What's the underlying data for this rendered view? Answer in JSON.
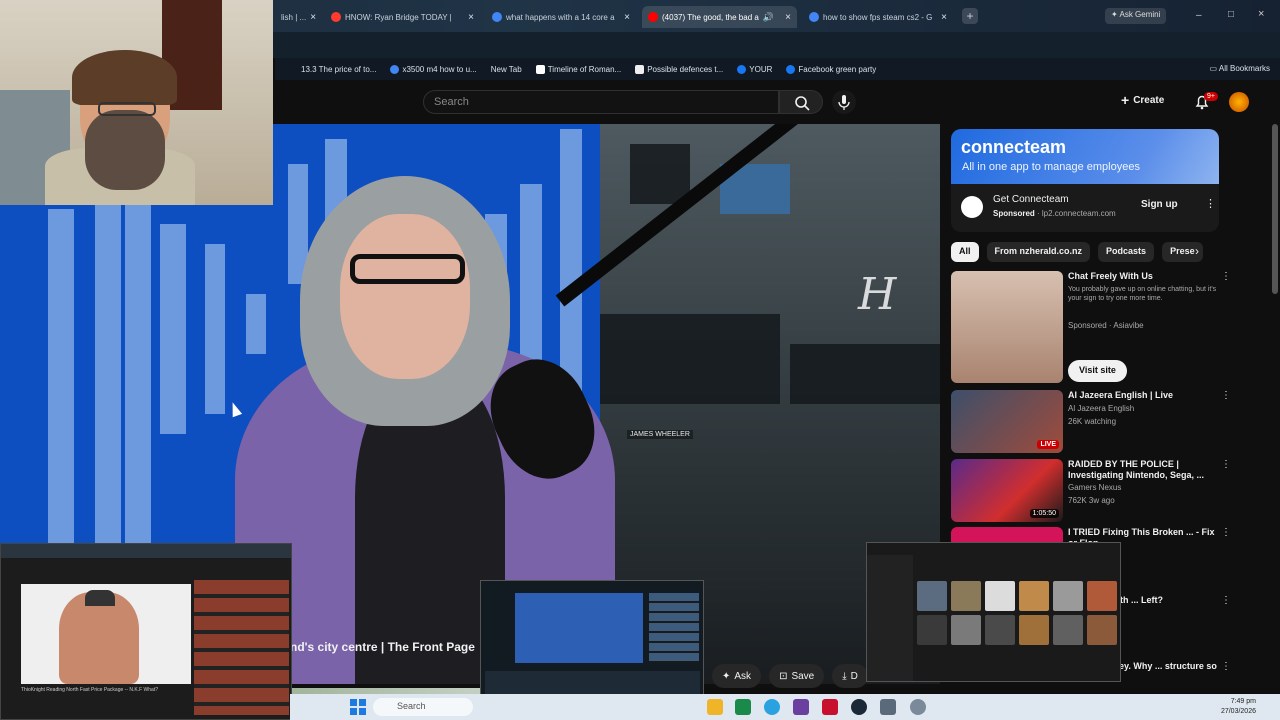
{
  "browser": {
    "tabs": [
      {
        "label": "lish | ...",
        "color": "#e0e0e0",
        "active": false
      },
      {
        "label": "HNOW: Ryan Bridge TODAY |",
        "color": "#ff3b30",
        "active": false
      },
      {
        "label": "what happens with a 14 core a",
        "color": "#4285f4",
        "active": false
      },
      {
        "label": "(4037) The good, the bad a",
        "color": "#ff0000",
        "active": true
      },
      {
        "label": "how to show fps steam cs2 - G",
        "color": "#4285f4",
        "active": false
      }
    ],
    "ask_gemini_label": "Ask Gemini",
    "bookmarks": [
      {
        "label": "13.3 The price of to...",
        "color": "#ffffff"
      },
      {
        "label": "x3500 m4 how to u...",
        "color": "#4285f4"
      },
      {
        "label": "New Tab",
        "color": "#3a8cf0"
      },
      {
        "label": "Timeline of Roman...",
        "color": "#ffffff"
      },
      {
        "label": "Possible defences t...",
        "color": "#ffffff"
      },
      {
        "label": "YOUR",
        "color": "#1877f2"
      },
      {
        "label": "Facebook green party",
        "color": "#1877f2"
      }
    ],
    "all_bookmarks_label": "All Bookmarks"
  },
  "youtube": {
    "search_placeholder": "Search",
    "create_label": "Create",
    "notifications_badge": "9+",
    "video": {
      "title": "nd's city centre | The Front Page",
      "name_tag": "JAMES WHEELER",
      "logo": "H"
    },
    "actions": [
      {
        "icon": "sparkle-icon",
        "label": "Ask"
      },
      {
        "icon": "bookmark-icon",
        "label": "Save"
      },
      {
        "icon": "download-icon",
        "label": "D"
      }
    ],
    "ad": {
      "brand": "connecteam",
      "tagline": "All in one app to manage employees",
      "name": "Get Connecteam",
      "sponsored": "Sponsored",
      "domain": "lp2.connecteam.com",
      "signup_label": "Sign up",
      "more": "⋮"
    },
    "chips": [
      "All",
      "From nzherald.co.nz",
      "Podcasts",
      "Prese"
    ],
    "recommendations": [
      {
        "title": "Chat Freely With Us",
        "desc": "You probably gave up on online chatting, but it's your sign to try one more time.",
        "channel": "Sponsored · Asiavibe",
        "badge": "",
        "color": "#c9a690"
      },
      {
        "title": "Al Jazeera English | Live",
        "channel": "Al Jazeera English",
        "meta": "26K watching",
        "badge": "LIVE",
        "color": "#6a4a3a"
      },
      {
        "title": "RAIDED BY THE POLICE | Investigating Nintendo, Sega, ...",
        "channel": "Gamers Nexus",
        "meta": "762K  3w ago",
        "badge": "1:05:50",
        "color": "#a83a2a"
      },
      {
        "title": "I TRIED Fixing This Broken ... - Fix or Flop ...",
        "channel": "",
        "meta": "",
        "badge": "",
        "color": "#d4145a"
      },
      {
        "title": "oil Does Earth ... Left?",
        "channel": "",
        "meta": "ago",
        "badge": "",
        "color": "#0f0f0f"
      },
      {
        "title": "ing the money. Why ... structure so bad? |...",
        "channel": "",
        "meta": "",
        "badge": "",
        "color": "#0f0f0f"
      }
    ],
    "visit_site_label": "Visit site"
  },
  "taskbar": {
    "search_placeholder": "Search",
    "time": "7:49 pm",
    "date": "27/03/2026"
  },
  "overlays": {
    "left_caption": "ThioKnight Reading North Fast Price Package -- N.K.F What?"
  }
}
